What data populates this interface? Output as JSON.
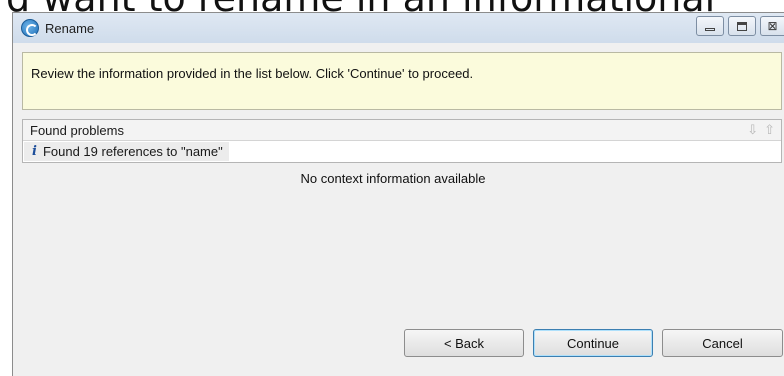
{
  "background_caption": "d want to rename in an informational",
  "window": {
    "title": "Rename",
    "app_icon": "rename-app-icon",
    "controls": {
      "minimize": "minimize-icon",
      "maximize": "maximize-icon",
      "close_glyph": "⊠"
    }
  },
  "info": {
    "message": "Review the information provided in the list below. Click 'Continue' to proceed."
  },
  "problems": {
    "header": "Found problems",
    "nav_down_glyph": "⇩",
    "nav_up_glyph": "⇧",
    "items": [
      {
        "icon_glyph": "i",
        "text": "Found 19 references to \"name\""
      }
    ]
  },
  "context": {
    "text": "No context information available"
  },
  "buttons": {
    "back": "< Back",
    "continue": "Continue",
    "cancel": "Cancel"
  },
  "colors": {
    "info_bg": "#fbfbdc",
    "titlebar": "#d6e2ef",
    "info_icon": "#1d4e9a",
    "default_button_border": "#3c7fb1"
  }
}
